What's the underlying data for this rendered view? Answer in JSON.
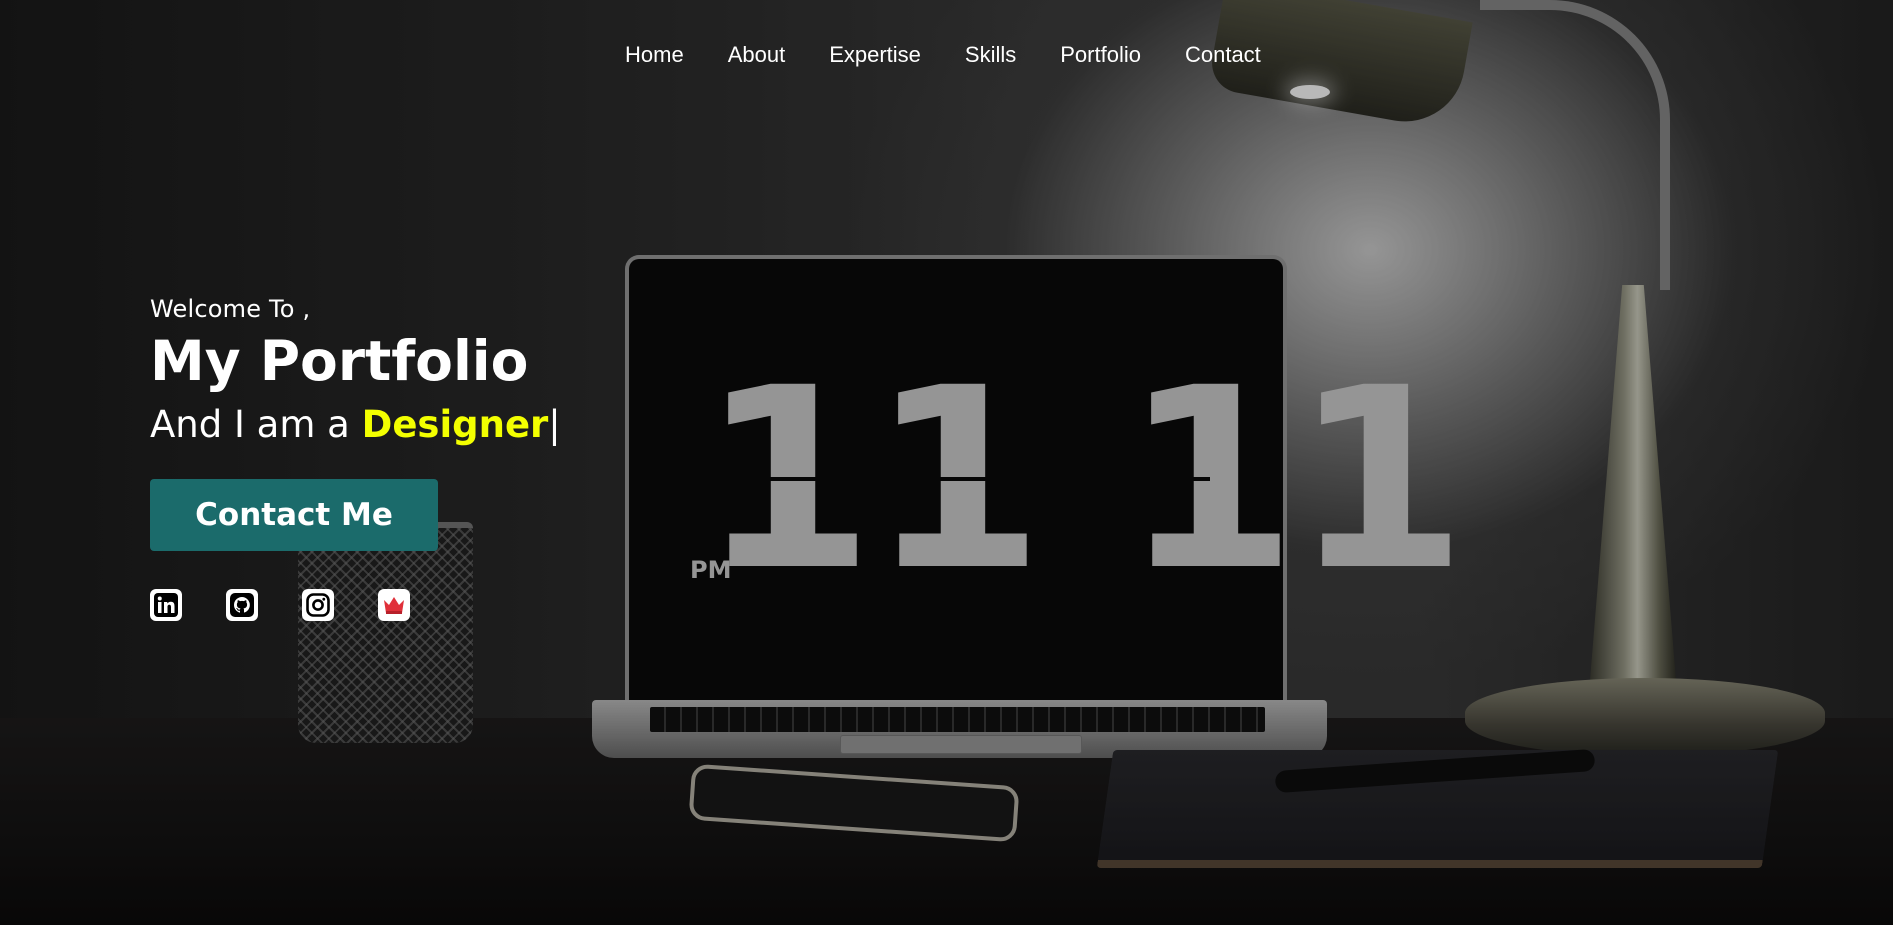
{
  "nav": {
    "items": [
      "Home",
      "About",
      "Expertise",
      "Skills",
      "Portfolio",
      "Contact"
    ]
  },
  "hero": {
    "welcome": "Welcome To ,",
    "title": "My Portfolio",
    "tagline_prefix": "And I am a",
    "role": "Designer",
    "cursor": "|",
    "cta_label": "Contact Me"
  },
  "background": {
    "clock_digits": "11 11",
    "clock_period": "PM"
  },
  "socials": [
    {
      "icon": "linkedin-icon"
    },
    {
      "icon": "github-icon"
    },
    {
      "icon": "instagram-icon"
    },
    {
      "icon": "crown-icon"
    }
  ],
  "colors": {
    "accent_yellow": "#f3ff00",
    "button_teal": "#1b6b6b",
    "crown_red": "#e0303a"
  }
}
